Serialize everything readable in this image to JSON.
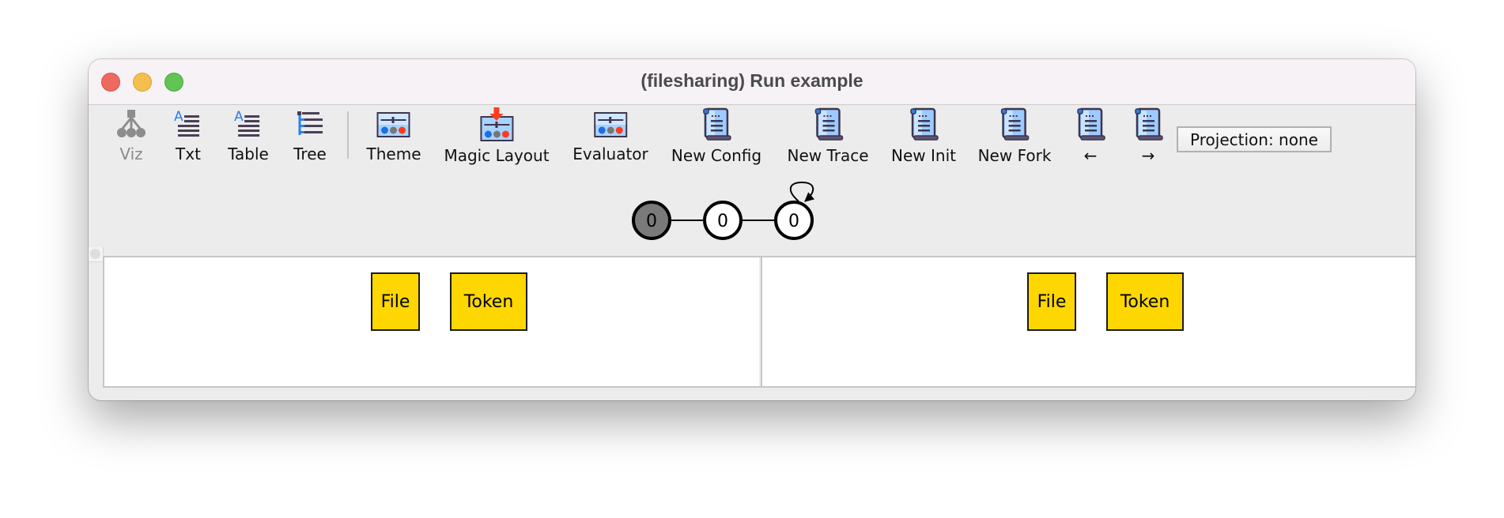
{
  "window": {
    "title": "(filesharing) Run example",
    "traffic_lights": [
      "close",
      "minimize",
      "zoom"
    ]
  },
  "toolbar": {
    "items": [
      {
        "label": "Viz",
        "icon": "graph-tree-icon",
        "enabled": false
      },
      {
        "label": "Txt",
        "icon": "text-lines-icon",
        "enabled": true
      },
      {
        "label": "Table",
        "icon": "table-lines-icon",
        "enabled": true
      },
      {
        "label": "Tree",
        "icon": "tree-list-icon",
        "enabled": true
      },
      {
        "label": "Theme",
        "icon": "theme-panel-icon",
        "enabled": true
      },
      {
        "label": "Magic Layout",
        "icon": "magic-layout-icon",
        "enabled": true
      },
      {
        "label": "Evaluator",
        "icon": "evaluator-panel-icon",
        "enabled": true
      },
      {
        "label": "New Config",
        "icon": "scroll-icon",
        "enabled": true
      },
      {
        "label": "New Trace",
        "icon": "scroll-icon",
        "enabled": true
      },
      {
        "label": "New Init",
        "icon": "scroll-icon",
        "enabled": true
      },
      {
        "label": "New Fork",
        "icon": "scroll-icon",
        "enabled": true
      },
      {
        "label": "←",
        "icon": "scroll-icon",
        "enabled": true
      },
      {
        "label": "→",
        "icon": "scroll-icon",
        "enabled": true
      }
    ],
    "projection": "Projection: none"
  },
  "trace_graph": {
    "nodes": [
      {
        "label": "0",
        "state": "current"
      },
      {
        "label": "0",
        "state": "normal"
      },
      {
        "label": "0",
        "state": "normal",
        "self_loop": true
      }
    ],
    "edges": [
      [
        0,
        1
      ],
      [
        1,
        2
      ],
      [
        2,
        2
      ]
    ]
  },
  "panels": [
    {
      "atoms": [
        "File",
        "Token"
      ]
    },
    {
      "atoms": [
        "File",
        "Token"
      ]
    }
  ],
  "colors": {
    "atom_fill": "#ffd700",
    "current_node": "#7a7a7a",
    "accent_blue": "#2f7fe6",
    "accent_red": "#ff3b1f"
  }
}
